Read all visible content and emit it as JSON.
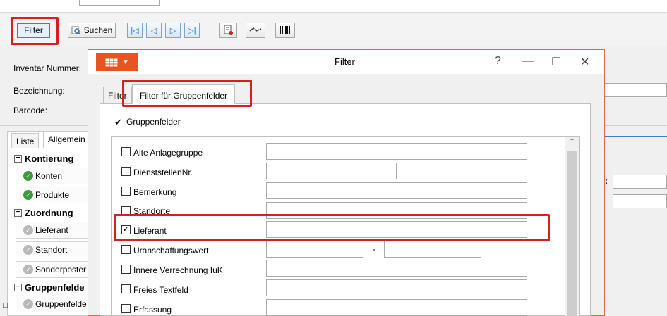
{
  "toolbar": {
    "filter_label": "Filter",
    "suchen_label": "Suchen",
    "nav_icons": [
      "first-record-icon",
      "previous-record-icon",
      "next-record-icon",
      "last-record-icon"
    ]
  },
  "form": {
    "inventar_label": "Inventar Nummer:",
    "bezeichnung_label": "Bezeichnung:",
    "barcode_label": "Barcode:"
  },
  "left_tabs": [
    "Liste",
    "Allgemein"
  ],
  "tree": {
    "groups": [
      {
        "label": "Kontierung",
        "items": [
          "Konten",
          "Produkte"
        ]
      },
      {
        "label": "Zuordnung",
        "items": [
          "Lieferant",
          "Standort",
          "Sonderposter"
        ]
      },
      {
        "label": "Gruppenfelde",
        "items": [
          "Gruppenfelde"
        ]
      }
    ]
  },
  "dialog": {
    "title": "Filter",
    "help": "?",
    "minimize": "—",
    "maximize": "☐",
    "close": "✕",
    "tabs": [
      "Filter",
      "Filter für Gruppenfelder"
    ],
    "gruppenfelder_label": "Gruppenfelder",
    "gruppenfelder_checked": true,
    "fields": [
      {
        "label": "Alte Anlagegruppe",
        "checked": false
      },
      {
        "label": "DienststellenNr.",
        "checked": false
      },
      {
        "label": "Bemerkung",
        "checked": false
      },
      {
        "label": "Standorte",
        "checked": false
      },
      {
        "label": "Lieferant",
        "checked": true
      },
      {
        "label": "Uranschaffungswert",
        "checked": false,
        "range_separator": "-"
      },
      {
        "label": "Innere Verrechnung IuK",
        "checked": false
      },
      {
        "label": "Freies Textfeld",
        "checked": false
      },
      {
        "label": "Erfassung",
        "checked": false
      }
    ]
  },
  "colors": {
    "highlight_red": "#d62020",
    "dialog_menu_orange": "#e8531f",
    "focus_blue": "#3c7fc9"
  }
}
